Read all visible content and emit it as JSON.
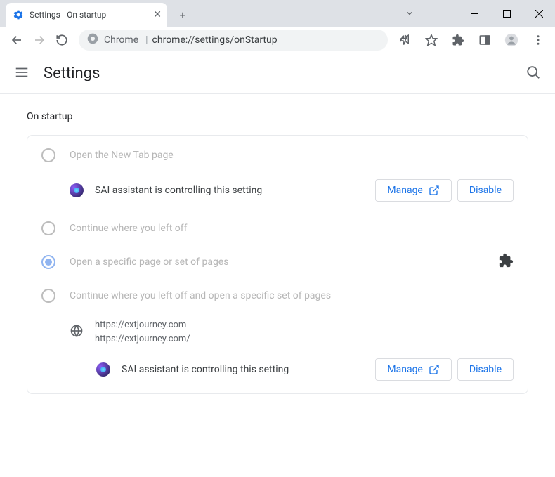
{
  "window": {
    "tab_title": "Settings - On startup"
  },
  "omnibox": {
    "prefix": "Chrome",
    "url": "chrome://settings/onStartup"
  },
  "header": {
    "title": "Settings"
  },
  "section": {
    "title": "On startup"
  },
  "options": {
    "new_tab": "Open the New Tab page",
    "continue": "Continue where you left off",
    "specific": "Open a specific page or set of pages",
    "continue_specific": "Continue where you left off and open a specific set of pages"
  },
  "managed": {
    "text": "SAI assistant is controlling this setting",
    "manage_btn": "Manage",
    "disable_btn": "Disable"
  },
  "page_entry": {
    "title": "https://extjourney.com",
    "url": "https://extjourney.com/"
  }
}
